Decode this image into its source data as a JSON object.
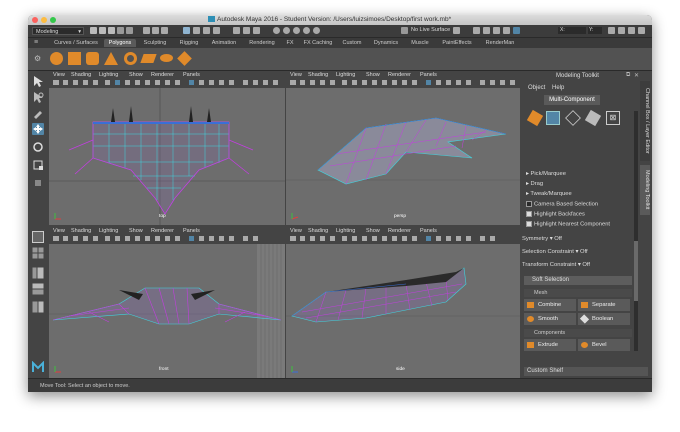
{
  "window": {
    "title": "Autodesk Maya 2016 - Student Version: /Users/luizsimoes/Desktop/first work.mb*"
  },
  "menubar": {
    "mode": "Modeling",
    "live_surface": "No Live Surface"
  },
  "shelf_tabs": [
    "Curves / Surfaces",
    "Polygons",
    "Sculpting",
    "Rigging",
    "Animation",
    "Rendering",
    "FX",
    "FX Caching",
    "Custom",
    "Dynamics",
    "Muscle",
    "PaintEffects",
    "RenderMan"
  ],
  "shelf_active": "Polygons",
  "viewport_menu": [
    "View",
    "Shading",
    "Lighting",
    "Show",
    "Renderer",
    "Panels"
  ],
  "viewports": {
    "top": {
      "label": "top"
    },
    "persp": {
      "label": "persp"
    },
    "front": {
      "label": "front"
    },
    "side": {
      "label": "side"
    }
  },
  "modeling_toolkit": {
    "title": "Modeling Toolkit",
    "menu": [
      "Object",
      "Help"
    ],
    "mode_button": "Multi-Component",
    "tools": [
      "Pick/Marquee",
      "Drag",
      "Tweak/Marquee"
    ],
    "camera_based": "Camera Based Selection",
    "highlight_backfaces": "Highlight Backfaces",
    "highlight_nearest": "Highlight Nearest Component",
    "symmetry_label": "Symmetry",
    "symmetry_value": "Off",
    "selection_constraint_label": "Selection Constraint",
    "selection_constraint_value": "Off",
    "transform_constraint_label": "Transform Constraint",
    "transform_constraint_value": "Off",
    "soft_selection": "Soft Selection",
    "mesh_section": "Mesh",
    "mesh_buttons": [
      "Combine",
      "Separate",
      "Smooth",
      "Boolean"
    ],
    "components_section": "Components",
    "component_buttons": [
      "Extrude",
      "Bevel"
    ],
    "custom_shelf": "Custom Shelf"
  },
  "side_tabs": [
    "Channel Box / Layer Editor",
    "Modeling Toolkit"
  ],
  "status": {
    "text": "Move Tool: Select an object to move."
  },
  "colors": {
    "wire_blue": "#3a6fd6",
    "wire_magenta": "#c23fe0",
    "wire_cyan": "#3fd6e0",
    "vp_bg": "#6d6d6d",
    "orange_icon": "#e08a2a",
    "accent_blue": "#5285a6"
  }
}
